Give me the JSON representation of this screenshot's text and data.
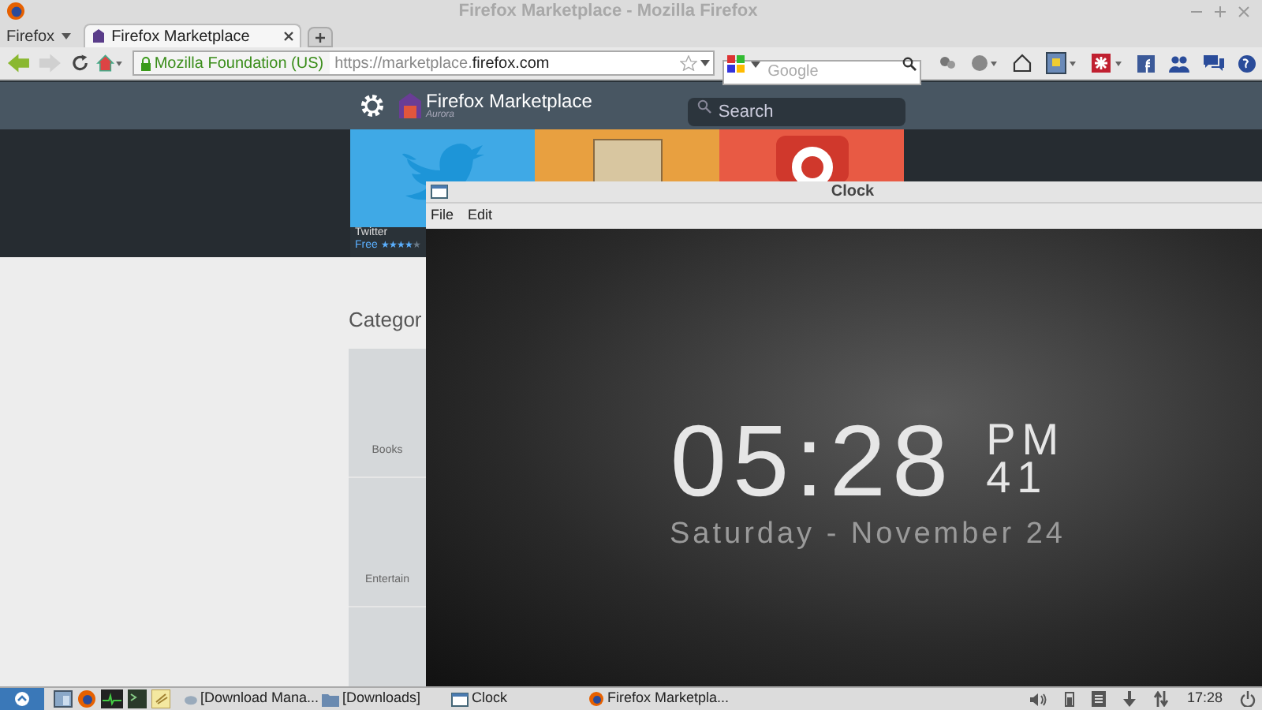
{
  "window": {
    "title": "Firefox Marketplace - Mozilla Firefox"
  },
  "menu_button": "Firefox",
  "tabs": [
    {
      "label": "Firefox Marketplace",
      "selected": true
    }
  ],
  "nav": {
    "identity": "Mozilla Foundation (US)",
    "url_prefix": "https://marketplace.",
    "url_domain": "firefox.com",
    "search_placeholder": "Google"
  },
  "marketplace": {
    "logo": "Firefox Marketplace",
    "channel": "Aurora",
    "search_placeholder": "Search",
    "tiles": [
      {
        "kind": "bird",
        "color": "#3fa9e6",
        "name": "Twitter",
        "price": "Free",
        "stars": 4
      },
      {
        "kind": "cards",
        "color": "#e8a040"
      },
      {
        "kind": "ring",
        "color": "#e85a44"
      }
    ],
    "categories_heading": "Categor",
    "categories": [
      "Books",
      "Entertain"
    ]
  },
  "clock_window": {
    "title": "Clock",
    "menus": [
      "File",
      "Edit"
    ],
    "time": "05:28",
    "meridiem": "PM",
    "seconds": "41",
    "date": "Saturday - November 24"
  },
  "taskbar": {
    "tasks": [
      {
        "kind": "download",
        "label": "[Download Mana..."
      },
      {
        "kind": "folder",
        "label": "[Downloads]"
      },
      {
        "kind": "window",
        "label": "Clock"
      },
      {
        "kind": "firefox",
        "label": "Firefox Marketpla..."
      }
    ],
    "time": "17:28"
  }
}
